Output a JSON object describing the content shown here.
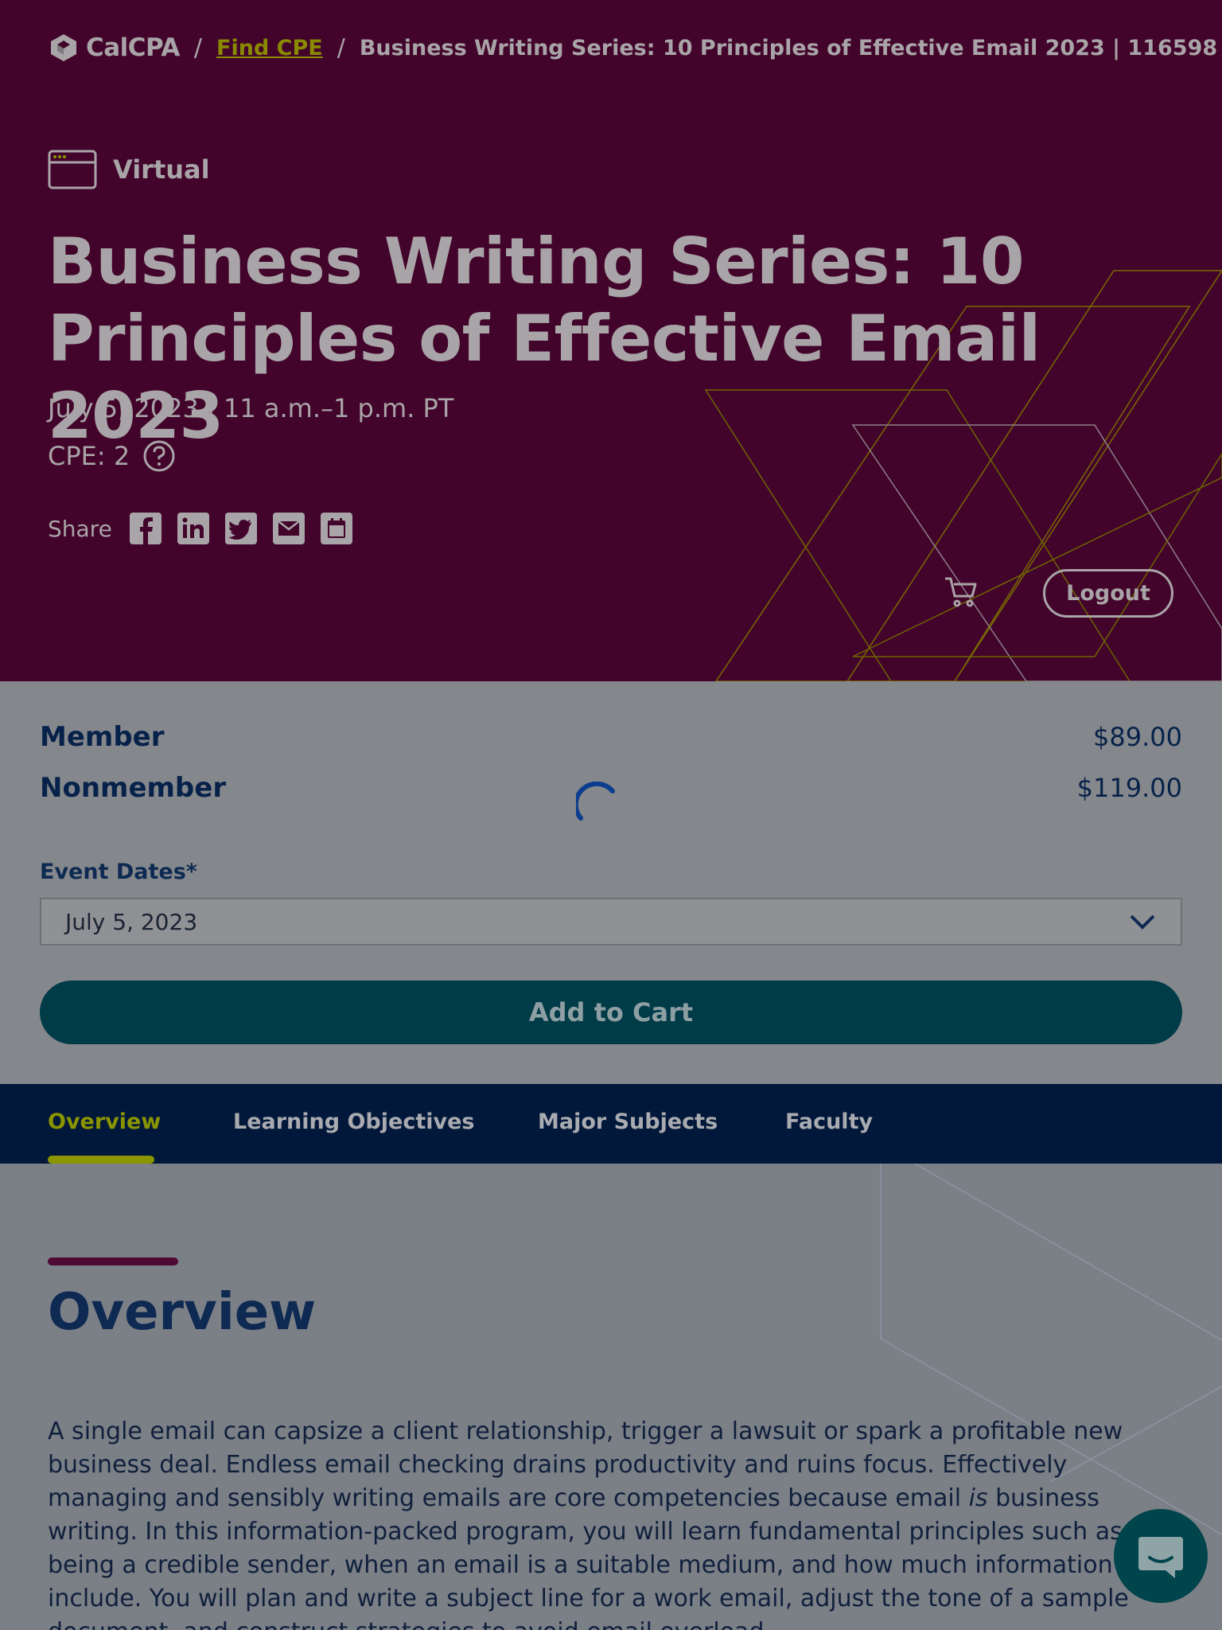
{
  "breadcrumb": {
    "brand": "CalCPA",
    "separator": "/",
    "link": "Find CPE",
    "current": "Business Writing Series: 10 Principles of Effective Email 2023 | 116598"
  },
  "event": {
    "format": "Virtual",
    "title": "Business Writing Series: 10 Principles of Effective Email 2023",
    "datetime": "July 5, 2023 | 11 a.m.–1 p.m. PT",
    "cpe": "CPE: 2",
    "share_label": "Share"
  },
  "share_icons": [
    "facebook-icon",
    "linkedin-icon",
    "twitter-icon",
    "email-icon",
    "calendar-icon"
  ],
  "header_actions": {
    "logout_label": "Logout"
  },
  "pricing": {
    "rows": [
      {
        "label": "Member",
        "price": "$89.00"
      },
      {
        "label": "Nonmember",
        "price": "$119.00"
      }
    ]
  },
  "form": {
    "dates_label": "Event Dates*",
    "dates_value": "July 5, 2023",
    "add_to_cart_label": "Add to Cart"
  },
  "tabs": [
    {
      "label": "Overview",
      "active": true
    },
    {
      "label": "Learning Objectives",
      "active": false
    },
    {
      "label": "Major Subjects",
      "active": false
    },
    {
      "label": "Faculty",
      "active": false
    }
  ],
  "overview": {
    "heading": "Overview",
    "p1": "A single email can capsize a client relationship, trigger a lawsuit or spark a profitable new business deal. Endless email checking drains productivity and ruins focus. Effectively managing and sensibly writing emails are core competencies because email ",
    "p_em": "is",
    "p2": " business writing. In this information-packed program, you will learn fundamental principles such as being a credible sender, when an email is a suitable medium, and how much information to include. You will plan and write a subject line for a work email, adjust the tone of a sample document, and construct strategies to avoid email overload."
  },
  "colors": {
    "hero_bg": "#42042b",
    "accent_olive": "#8a9500",
    "navy": "#02183a",
    "teal_button": "#003b48"
  }
}
